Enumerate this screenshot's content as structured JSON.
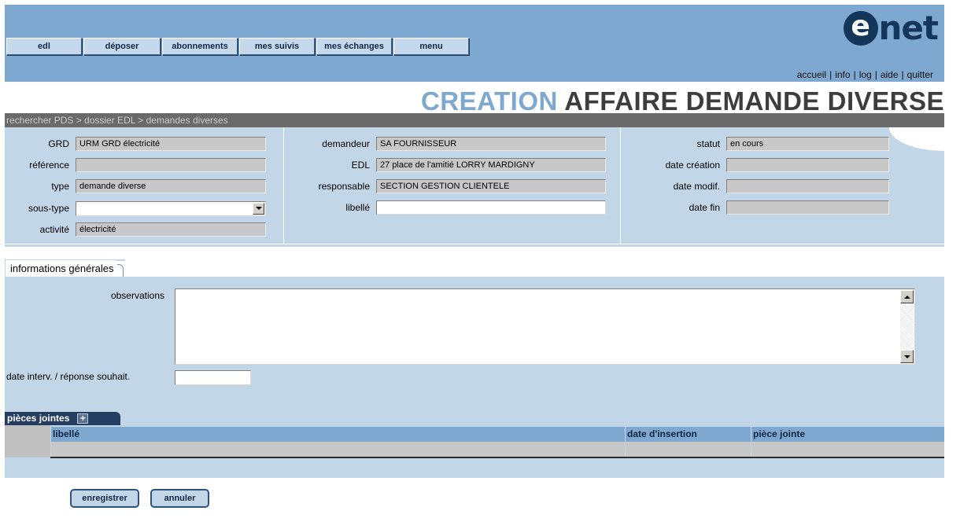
{
  "nav": {
    "buttons": [
      "edl",
      "déposer",
      "abonnements",
      "mes suivis",
      "mes échanges",
      "menu"
    ]
  },
  "logo": {
    "letter": "e",
    "text": "net"
  },
  "toplinks": {
    "items": [
      "accueil",
      "info",
      "log",
      "aide",
      "quitter"
    ],
    "separator": "|"
  },
  "page_title": {
    "part1": "CREATION",
    "part2": "AFFAIRE DEMANDE DIVERSE"
  },
  "breadcrumb": "rechercher PDS > dossier EDL > demandes diverses",
  "header": {
    "col1": {
      "grd": {
        "label": "GRD",
        "value": "URM GRD électricité"
      },
      "reference": {
        "label": "référence",
        "value": ""
      },
      "type": {
        "label": "type",
        "value": "demande diverse"
      },
      "sous_type": {
        "label": "sous-type",
        "value": ""
      },
      "activite": {
        "label": "activité",
        "value": "électricité"
      }
    },
    "col2": {
      "demandeur": {
        "label": "demandeur",
        "value": "SA FOURNISSEUR"
      },
      "edl": {
        "label": "EDL",
        "value": "27 place de l'amitié LORRY MARDIGNY"
      },
      "responsable": {
        "label": "responsable",
        "value": "SECTION GESTION CLIENTELE"
      },
      "libelle": {
        "label": "libellé",
        "value": ""
      }
    },
    "col3": {
      "statut": {
        "label": "statut",
        "value": "en cours"
      },
      "date_creation": {
        "label": "date création",
        "value": ""
      },
      "date_modif": {
        "label": "date modif.",
        "value": ""
      },
      "date_fin": {
        "label": "date fin",
        "value": ""
      }
    }
  },
  "tab": {
    "label": "informations générales"
  },
  "general": {
    "observations_label": "observations",
    "observations_value": "",
    "date_label": "date interv. / réponse souhait.",
    "date_value": ""
  },
  "attachments": {
    "title": "pièces jointes",
    "add_symbol": "+",
    "columns": [
      "libellé",
      "date d'insertion",
      "pièce jointe"
    ],
    "rows": []
  },
  "actions": {
    "save": "enregistrer",
    "cancel": "annuler"
  },
  "colors": {
    "banner": "#7fa8d1",
    "panel": "#c3d6e8",
    "title_accent": "#7fa8d1",
    "title_dark": "#3d3d3d",
    "logo": "#15365b"
  }
}
